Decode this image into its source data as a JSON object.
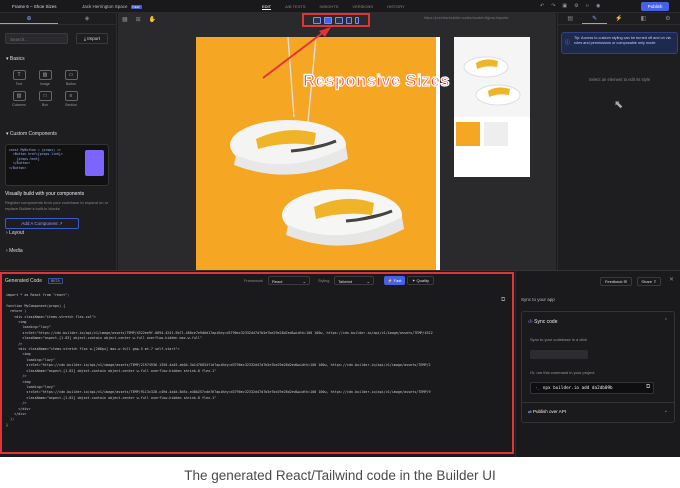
{
  "topbar": {
    "title": "Frame 6 – Shoe Sizes",
    "user": "Jack Herrington Space",
    "user_badge": "NEW",
    "tabs": [
      "EDIT",
      "A/B TESTS",
      "INSIGHTS",
      "VERSIONS",
      "HISTORY"
    ],
    "active_tab": "EDIT",
    "publish_label": "Publish"
  },
  "left_panel": {
    "search_placeholder": "Search...",
    "import_label": "Import",
    "basics_title": "Basics",
    "blocks": [
      "Text",
      "Image",
      "Button",
      "Columns",
      "Box",
      "Section"
    ],
    "custom_components_title": "Custom Components",
    "code_preview": "const MyButton = (props) =>\n  <Button href={props.link}>\n    {props.text}\n  </Button>\n</Button>",
    "visual_build_title": "Visually build with your components",
    "visual_build_desc": "Register components from your codebase to expand on or replace Builder's built-in blocks",
    "add_component_label": "Add A Component",
    "layout_label": "Layout",
    "media_label": "Media"
  },
  "canvas": {
    "url": "https://preview.builder.codes/model=figma-imports",
    "annotation": "Responsive Sizes"
  },
  "right_panel": {
    "tip": "Tip: Access to custom styling can be turned off and on via roles and permissions or composable only mode",
    "tip_icon": "info-icon",
    "select_hint": "Select an element to edit its style"
  },
  "generated_code": {
    "title": "Generated Code",
    "beta": "BETA",
    "framework_label": "Framework",
    "framework_value": "React",
    "styling_label": "Styling",
    "styling_value": "Tailwind",
    "fast_label": "Fast",
    "quality_label": "Quality",
    "code": "import * as React from \"react\";\n\nfunction MyComponent(props) {\n  return (\n    <div className=\"items-stretch flex-col\">\n      <img\n        loading=\"lazy\"\n        srcSet=\"https://cdn.builder.io/api/v1/image/assets/TEMP/4522ee9f-0094-4241-9b71-480ce7e9d0d1?apiKey=d3790ec32332d47d7b5e7be29e28d2ed&width=100 100w, https://cdn.builder.io/api/v1/image/assets/TEMP/4522\n        className=\"aspect-[1.03] object-contain object-center w-full overflow-hidden max-w-full\"\n      />\n      <div className=\"items-stretch flex w-[206px] max-w-full gap-5 mt-7 self-start\">\n        <img\n          loading=\"lazy\"\n          srcSet=\"https://cdn.builder.io/api/v1/image/assets/TEMP/21974936-1350-4a45-ab04-3a1476834f1d?apiKey=d3790ec32332d47d7b5e7be29e28d2ed&width=100 100w, https://cdn.builder.io/api/v1/image/assets/TEMP/2\n          className=\"aspect-[1.02] object-contain object-center w-full overflow-hidden shrink-0 flex-1\"\n        />\n        <img\n          loading=\"lazy\"\n          srcSet=\"https://cdn.builder.io/api/v1/image/assets/TEMP/9113c328-c49d-4a4d-8d5c-e48b257cde76?apiKey=d3790ec32332d47d7b5e7be29e28d2ed&width=100 100w, https://cdn.builder.io/api/v1/image/assets/TEMP/9\n          className=\"aspect-[1.02] object-contain object-center w-full overflow-hidden shrink-0 flex-1\"\n        />\n      </div>\n    </div>\n  );\n}"
  },
  "sync_panel": {
    "feedback_label": "Feedback",
    "share_label": "Share",
    "title": "Sync to your app",
    "section_title": "Sync code",
    "desc": "Sync to your codebase in a click",
    "run_label": "Or, run this command in your project",
    "command": "npx builder.io add da2db09b",
    "publish_api_label": "Publish over API"
  },
  "caption": "The generated React/Tailwind code in the Builder UI"
}
